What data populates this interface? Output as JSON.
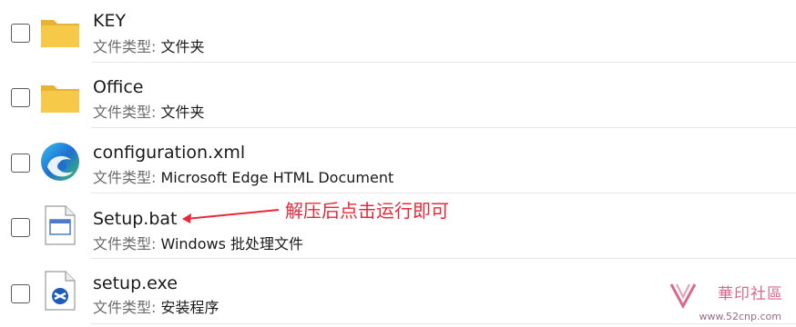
{
  "files": [
    {
      "name": "KEY",
      "type_label": "文件类型: ",
      "type": "文件夹",
      "icon": "folder-icon"
    },
    {
      "name": "Office",
      "type_label": "文件类型: ",
      "type": "文件夹",
      "icon": "folder-icon"
    },
    {
      "name": "configuration.xml",
      "type_label": "文件类型: ",
      "type": "Microsoft Edge HTML Document",
      "icon": "edge-icon"
    },
    {
      "name": "Setup.bat",
      "type_label": "文件类型: ",
      "type": "Windows 批处理文件",
      "icon": "batch-file-icon"
    },
    {
      "name": "setup.exe",
      "type_label": "文件类型: ",
      "type": "安装程序",
      "icon": "installer-icon"
    }
  ],
  "annotation": {
    "text": "解压后点击运行即可",
    "color": "#e8283a"
  },
  "watermark": {
    "text": "華印社區",
    "url": "www.52cnp.com"
  },
  "colors": {
    "folder": "#f7c948",
    "edge_blue": "#1f6fd1",
    "edge_green": "#3fbf6a"
  }
}
